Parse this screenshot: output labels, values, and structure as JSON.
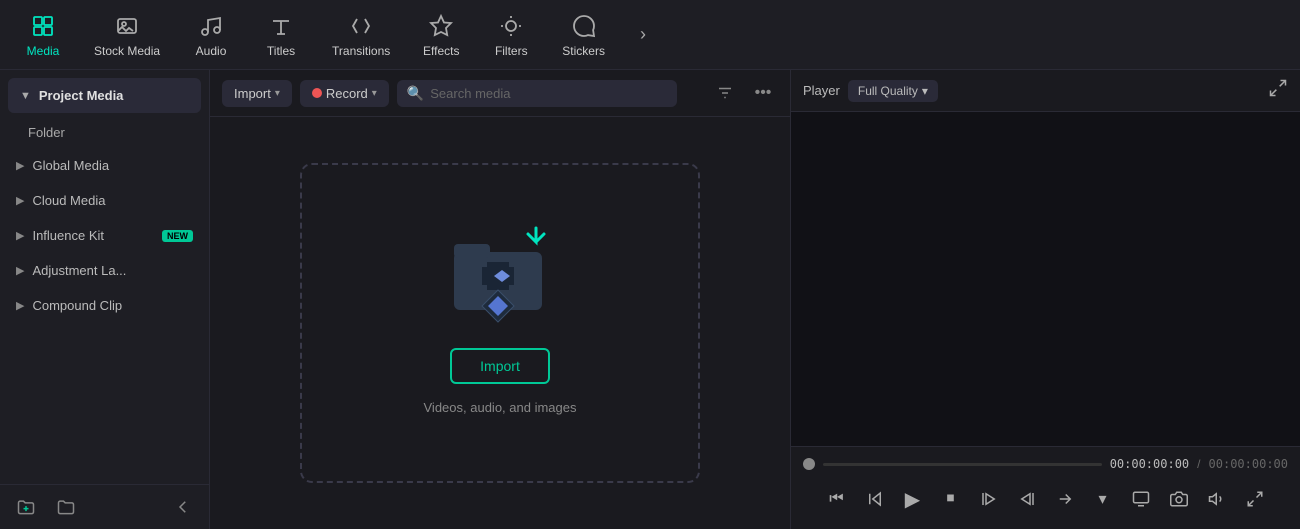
{
  "toolbar": {
    "items": [
      {
        "id": "media",
        "label": "Media",
        "active": true
      },
      {
        "id": "stock-media",
        "label": "Stock Media",
        "active": false
      },
      {
        "id": "audio",
        "label": "Audio",
        "active": false
      },
      {
        "id": "titles",
        "label": "Titles",
        "active": false
      },
      {
        "id": "transitions",
        "label": "Transitions",
        "active": false
      },
      {
        "id": "effects",
        "label": "Effects",
        "active": false
      },
      {
        "id": "filters",
        "label": "Filters",
        "active": false
      },
      {
        "id": "stickers",
        "label": "Stickers",
        "active": false
      }
    ]
  },
  "sidebar": {
    "project_media_label": "Project Media",
    "folder_label": "Folder",
    "items": [
      {
        "id": "global-media",
        "label": "Global Media",
        "badge": null
      },
      {
        "id": "cloud-media",
        "label": "Cloud Media",
        "badge": null
      },
      {
        "id": "influence-kit",
        "label": "Influence Kit",
        "badge": "NEW"
      },
      {
        "id": "adjustment-layer",
        "label": "Adjustment La...",
        "badge": null
      },
      {
        "id": "compound-clip",
        "label": "Compound Clip",
        "badge": null
      }
    ]
  },
  "media_panel": {
    "import_label": "Import",
    "record_label": "Record",
    "search_placeholder": "Search media",
    "import_button_label": "Import",
    "import_subtitle": "Videos, audio, and images"
  },
  "player": {
    "label": "Player",
    "quality": "Full Quality",
    "timecode_current": "00:00:00:00",
    "timecode_separator": "/",
    "timecode_total": "00:00:00:00"
  }
}
